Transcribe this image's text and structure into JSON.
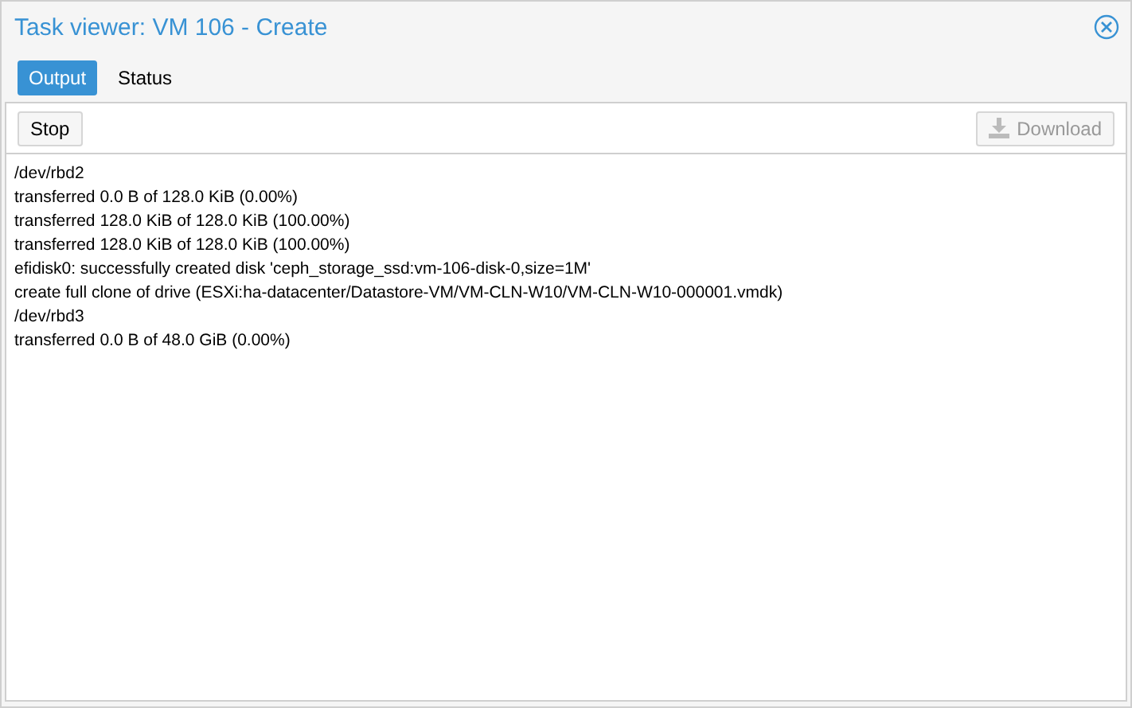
{
  "window": {
    "title": "Task viewer: VM 106 - Create"
  },
  "tabs": [
    {
      "label": "Output",
      "selected": true
    },
    {
      "label": "Status",
      "selected": false
    }
  ],
  "toolbar": {
    "buttons": [
      {
        "label": "Stop",
        "disabled": false,
        "icon": false
      },
      {
        "label": "Download",
        "disabled": true,
        "icon": true
      }
    ]
  },
  "log": [
    "/dev/rbd2",
    "transferred 0.0 B of 128.0 KiB (0.00%)",
    "transferred 128.0 KiB of 128.0 KiB (100.00%)",
    "transferred 128.0 KiB of 128.0 KiB (100.00%)",
    "efidisk0: successfully created disk 'ceph_storage_ssd:vm-106-disk-0,size=1M'",
    "create full clone of drive (ESXi:ha-datacenter/Datastore-VM/VM-CLN-W10/VM-CLN-W10-000001.vmdk)",
    "/dev/rbd3",
    "transferred 0.0 B of 48.0 GiB (0.00%)"
  ]
}
